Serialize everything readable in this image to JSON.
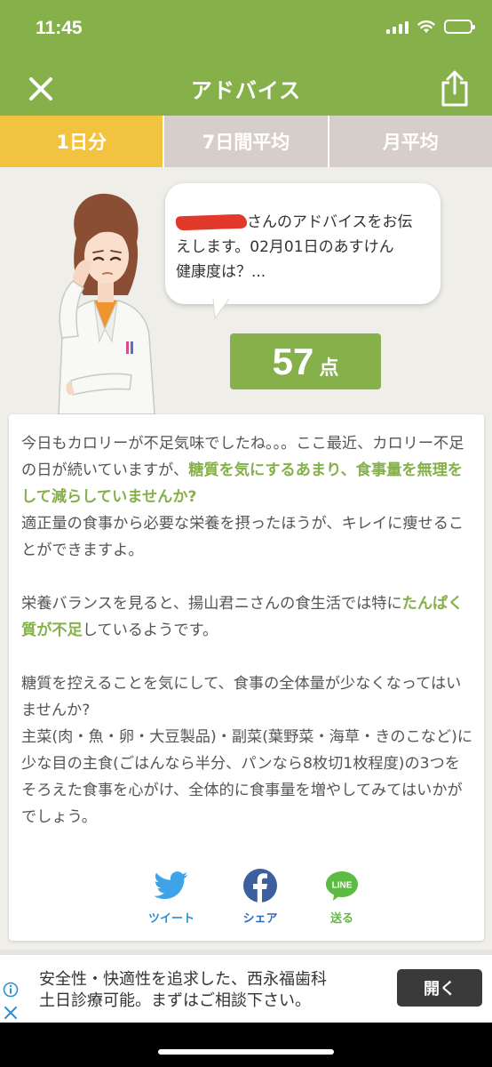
{
  "status": {
    "time": "11:45"
  },
  "nav": {
    "title": "アドバイス"
  },
  "tabs": [
    {
      "label": "1日分",
      "active": true
    },
    {
      "label": "7日間平均",
      "active": false
    },
    {
      "label": "月平均",
      "active": false
    }
  ],
  "bubble": {
    "text_line1": "さんのアドバイスをお伝",
    "text_line2": "えします。02月01日のあすけん",
    "text_line3": "健康度は？..."
  },
  "score": {
    "value": "57",
    "unit": "点"
  },
  "advice": {
    "p1_a": "今日もカロリーが不足気味でしたね。。。ここ最近、カロリー不足の日が続いていますが、",
    "p1_hl": "糖質を気にするあまり、食事量を無理をして減らしていませんか?",
    "p1_b": "適正量の食事から必要な栄養を摂ったほうが、キレイに痩せることができますよ。",
    "p2_a": "栄養バランスを見ると、揚山君ニさんの食生活では特に",
    "p2_hl": "たんぱく質が不足",
    "p2_b": "しているようです。",
    "p3": "糖質を控えることを気にして、食事の全体量が少なくなってはいませんか?",
    "p4": "主菜(肉・魚・卵・大豆製品)・副菜(葉野菜・海草・きのこなど)に少な目の主食(ごはんなら半分、パンなら8枚切1枚程度)の3つをそろえた食事を心がけ、全体的に食事量を増やしてみてはいかがでしょう。"
  },
  "share": {
    "twitter_label": "ツイート",
    "facebook_label": "シェア",
    "line_label": "送る",
    "line_icon_text": "LINE"
  },
  "ad": {
    "line1": "安全性・快適性を追求した、西永福歯科",
    "line2": "土日診療可能。まずはご相談下さい。",
    "button": "開く"
  },
  "colors": {
    "brand_green": "#86b04a",
    "tab_active": "#f2c33f",
    "tab_inactive": "#d6cfc9"
  }
}
